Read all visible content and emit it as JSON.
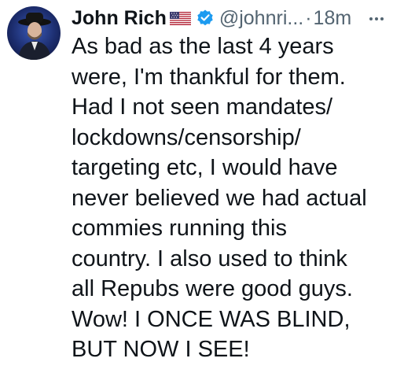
{
  "tweet": {
    "author_name": "John Rich",
    "handle": "@johnri...",
    "separator": "·",
    "timestamp": "18m",
    "text": "As bad as the last 4 years\nwere, I'm thankful for them.\nHad I not seen mandates/\nlockdowns/censorship/\ntargeting etc, I would have\nnever believed we had actual\ncommies running this\ncountry. I also used to think\nall Repubs were good guys.\nWow! I ONCE WAS BLIND,\nBUT NOW I SEE!"
  },
  "icons": {
    "flag": "us-flag-icon",
    "verified": "verified-badge-icon",
    "more": "more-options-icon"
  },
  "colors": {
    "verified": "#1d9bf0",
    "secondary_text": "#536471",
    "primary_text": "#0f1419"
  }
}
